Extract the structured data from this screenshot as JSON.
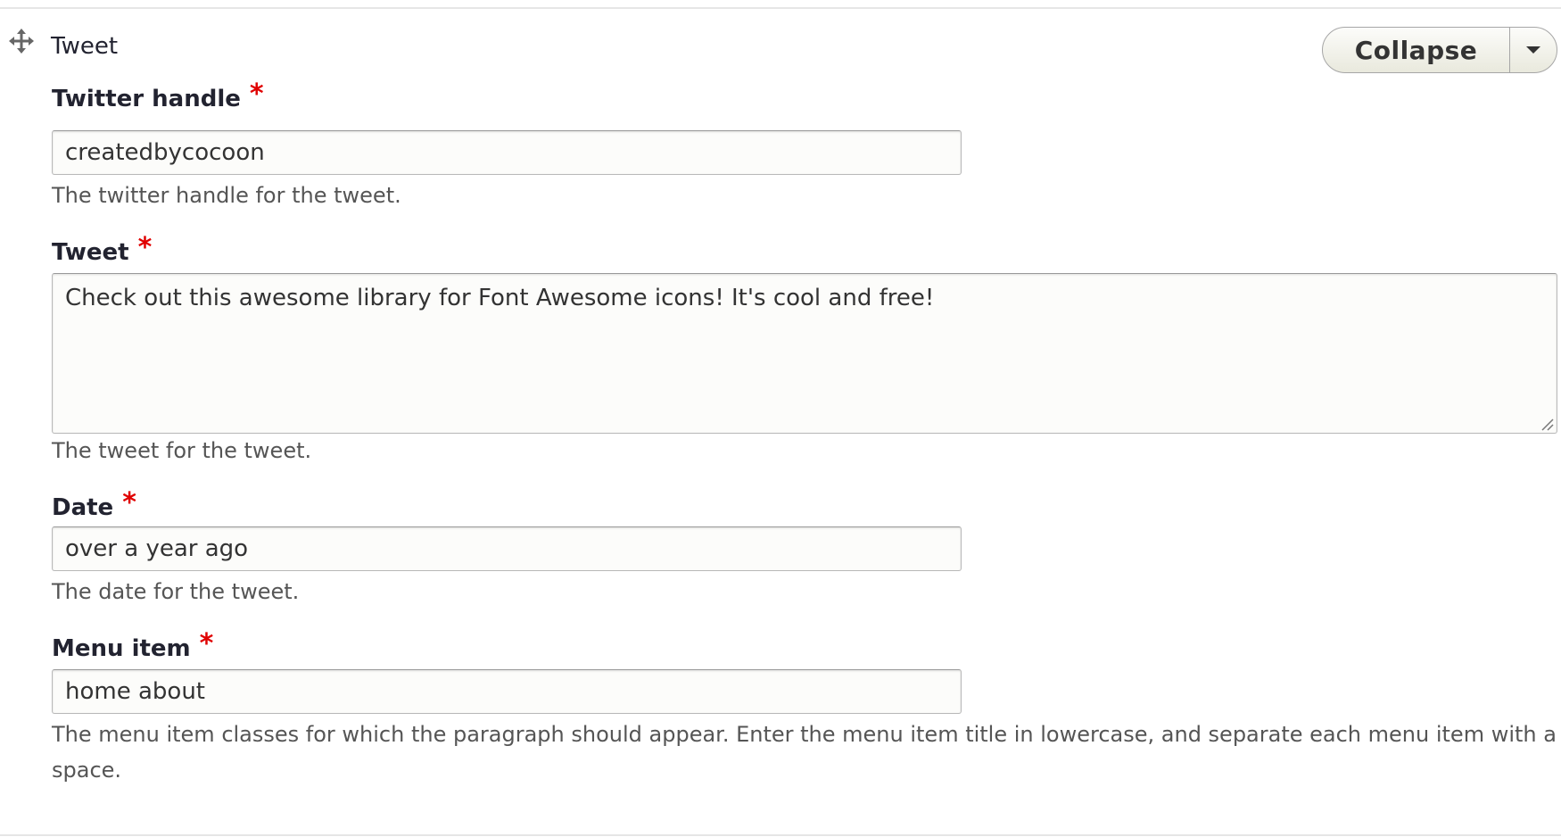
{
  "paragraph": {
    "title": "Tweet",
    "collapse_label": "Collapse"
  },
  "required_marker": "*",
  "fields": {
    "twitter_handle": {
      "label": "Twitter handle",
      "value": "createdbycocoon",
      "description": "The twitter handle for the tweet."
    },
    "tweet": {
      "label": "Tweet",
      "value": "Check out this awesome library for Font Awesome icons! It's cool and free!",
      "description": "The tweet for the tweet."
    },
    "date": {
      "label": "Date",
      "value": "over a year ago",
      "description": "The date for the tweet."
    },
    "menu_item": {
      "label": "Menu item",
      "value": "home about",
      "description": "The menu item classes for which the paragraph should appear. Enter the menu item title in lowercase, and separate each menu item with a space."
    }
  },
  "colors": {
    "required": "#e00000",
    "text": "#222330",
    "description": "#555555",
    "input_bg": "#fcfcfa"
  },
  "icons": {
    "drag": "move-arrows-icon",
    "toggle": "caret-down-icon",
    "resize": "resize-grip-icon"
  }
}
